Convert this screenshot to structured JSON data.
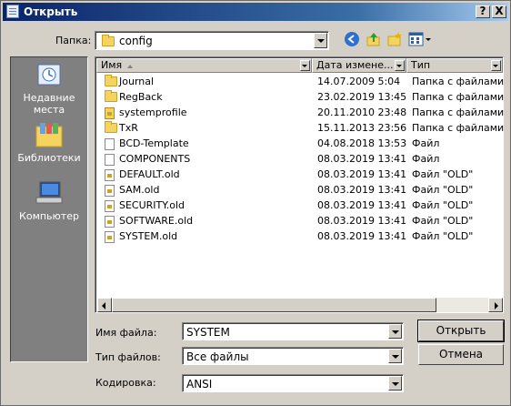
{
  "window": {
    "title": "Открыть",
    "close_label": "X",
    "help_label": "?"
  },
  "lookin": {
    "label": "Папка:",
    "value": "config"
  },
  "places": [
    {
      "label": "Недавние места",
      "icon": "recent-places-icon"
    },
    {
      "label": "Библиотеки",
      "icon": "libraries-icon"
    },
    {
      "label": "Компьютер",
      "icon": "computer-icon"
    }
  ],
  "columns": {
    "name": "Имя",
    "date": "Дата измене...",
    "type": "Тип"
  },
  "files": [
    {
      "name": "Journal",
      "date": "14.07.2009 5:04",
      "type": "Папка с файлами",
      "icon": "folder-icon"
    },
    {
      "name": "RegBack",
      "date": "23.02.2019 13:45",
      "type": "Папка с файлами",
      "icon": "folder-icon"
    },
    {
      "name": "systemprofile",
      "date": "20.11.2010 23:48",
      "type": "Папка с файлами",
      "icon": "locked-folder-icon"
    },
    {
      "name": "TxR",
      "date": "15.11.2013 23:56",
      "type": "Папка с файлами",
      "icon": "folder-icon"
    },
    {
      "name": "BCD-Template",
      "date": "04.08.2018 13:53",
      "type": "Файл",
      "icon": "file-icon"
    },
    {
      "name": "COMPONENTS",
      "date": "08.03.2019 13:41",
      "type": "Файл",
      "icon": "file-icon"
    },
    {
      "name": "DEFAULT.old",
      "date": "08.03.2019 13:41",
      "type": "Файл \"OLD\"",
      "icon": "locked-file-icon"
    },
    {
      "name": "SAM.old",
      "date": "08.03.2019 13:41",
      "type": "Файл \"OLD\"",
      "icon": "locked-file-icon"
    },
    {
      "name": "SECURITY.old",
      "date": "08.03.2019 13:41",
      "type": "Файл \"OLD\"",
      "icon": "locked-file-icon"
    },
    {
      "name": "SOFTWARE.old",
      "date": "08.03.2019 13:41",
      "type": "Файл \"OLD\"",
      "icon": "locked-file-icon"
    },
    {
      "name": "SYSTEM.old",
      "date": "08.03.2019 13:41",
      "type": "Файл \"OLD\"",
      "icon": "locked-file-icon"
    }
  ],
  "filename": {
    "label": "Имя файла:",
    "value": "SYSTEM"
  },
  "filetype": {
    "label": "Тип файлов:",
    "value": "Все файлы"
  },
  "encoding": {
    "label": "Кодировка:",
    "value": "ANSI"
  },
  "buttons": {
    "open": "Открыть",
    "cancel": "Отмена"
  }
}
